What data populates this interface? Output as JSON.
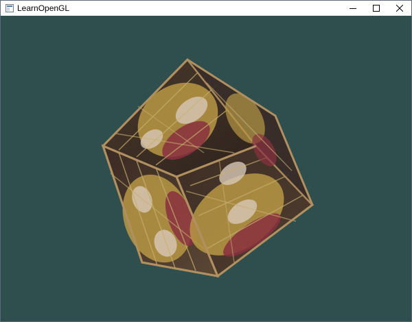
{
  "window": {
    "title": "LearnOpenGL",
    "buttons": [
      {
        "name": "minimize",
        "icon": "minimize-icon"
      },
      {
        "name": "maximize",
        "icon": "maximize-icon"
      },
      {
        "name": "close",
        "icon": "close-icon"
      }
    ]
  },
  "scene": {
    "clear_color": "#2f4f4f",
    "object": "textured-cube",
    "texture": "wooden-container-with-smiley-face",
    "colors": {
      "wood_dark": "#3a2a22",
      "wood_light": "#8a6a48",
      "frame": "#a8885c",
      "smiley_yellow": "#c8a84a",
      "smiley_red": "#8a3040"
    }
  }
}
